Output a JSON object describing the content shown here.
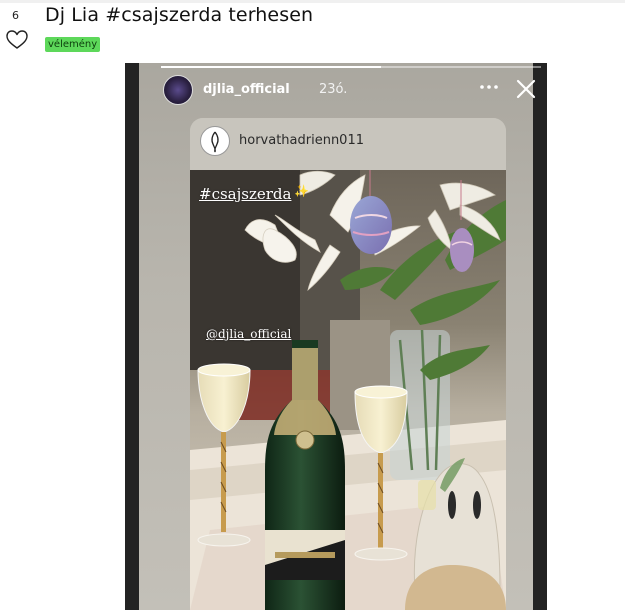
{
  "post": {
    "vote_count": "6",
    "title": "Dj Lia #csajszerda terhesen",
    "tag": "vélemény"
  },
  "story": {
    "username": "djlia_official",
    "time": "23ó.",
    "progress": 0.58,
    "repost": {
      "username": "horvathadrienn011",
      "hashtag": "#csajszerda",
      "mention": "@djlia_official"
    }
  },
  "icons": {
    "heart": "heart-outline-icon",
    "more": "more-dots-icon",
    "close": "close-icon",
    "sparkle": "sparkle-icon"
  },
  "colors": {
    "tag_bg": "#5dd85a",
    "story_edge": "#232323"
  }
}
